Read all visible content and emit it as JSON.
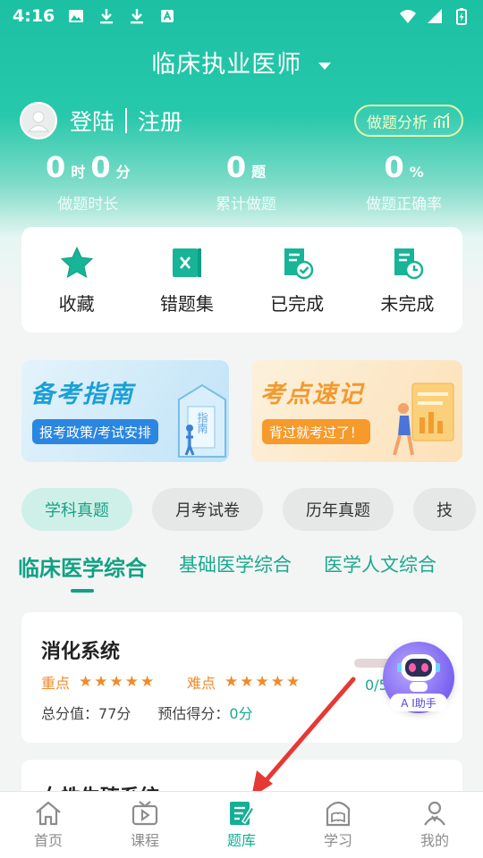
{
  "status_bar": {
    "time": "4:16"
  },
  "header": {
    "title": "临床执业医师"
  },
  "user": {
    "login": "登陆",
    "register": "注册",
    "analysis_button": "做题分析"
  },
  "stats": {
    "duration": {
      "hours_value": "0",
      "hours_unit": "时",
      "minutes_value": "0",
      "minutes_unit": "分",
      "label": "做题时长"
    },
    "total": {
      "value": "0",
      "unit": "题",
      "label": "累计做题"
    },
    "accuracy": {
      "value": "0",
      "unit": "%",
      "label": "做题正确率"
    }
  },
  "quick_actions": [
    {
      "label": "收藏",
      "icon": "star-icon"
    },
    {
      "label": "错题集",
      "icon": "wrong-book-icon"
    },
    {
      "label": "已完成",
      "icon": "completed-doc-icon"
    },
    {
      "label": "未完成",
      "icon": "pending-doc-icon"
    }
  ],
  "banners": {
    "guide": {
      "title": "备考指南",
      "subtitle": "报考政策/考试安排",
      "book_text": "指南"
    },
    "notes": {
      "title": "考点速记",
      "subtitle": "背过就考过了！"
    }
  },
  "chips": [
    "学科真题",
    "月考试卷",
    "历年真题",
    "技"
  ],
  "subjects": [
    "临床医学综合",
    "基础医学综合",
    "医学人文综合"
  ],
  "system_card": {
    "name": "消化系统",
    "key_label": "重点",
    "key_stars": "★★★★★",
    "difficulty_label": "难点",
    "difficulty_stars": "★★★★★",
    "total_label": "总分值：",
    "total_value": "77分",
    "estimate_label": "预估得分：",
    "estimate_value": "0分",
    "progress_text": "0/5"
  },
  "system_card2": {
    "name": "女性生殖系统"
  },
  "ai_assistant": {
    "label": "A I助手"
  },
  "tabs": [
    {
      "label": "首页",
      "icon": "home-icon"
    },
    {
      "label": "课程",
      "icon": "video-course-icon"
    },
    {
      "label": "题库",
      "icon": "question-bank-icon"
    },
    {
      "label": "学习",
      "icon": "study-icon"
    },
    {
      "label": "我的",
      "icon": "profile-icon"
    }
  ],
  "colors": {
    "brand": "#1cc0a2",
    "accent_orange": "#f18a2a",
    "arrow": "#e53935"
  }
}
